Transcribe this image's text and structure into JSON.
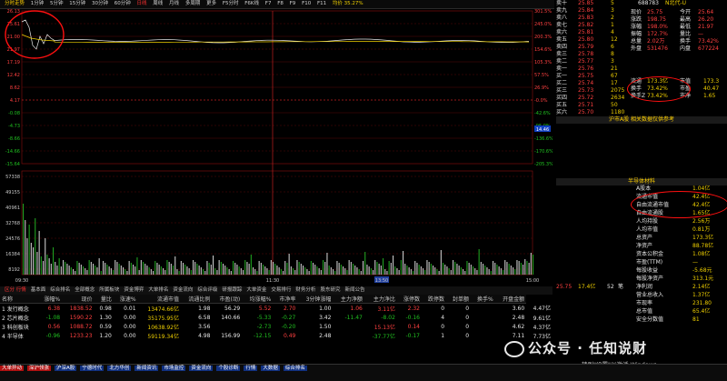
{
  "colors": {
    "up": "#ff4040",
    "down": "#20c020",
    "price_line": "#e8e8e8",
    "avg_line": "#f0d000",
    "annotation": "#ff1010"
  },
  "toolbar": {
    "items": [
      "1分钟",
      "5分钟",
      "15分钟",
      "30分钟",
      "60分钟",
      "日线",
      "周线",
      "月线",
      "多周期",
      "更多",
      "F5分时",
      "F6K线",
      "F7",
      "F8",
      "F9",
      "F10",
      "F11"
    ],
    "active_index": 5,
    "label_left": "分时走势",
    "label_right": "均价 35.27%"
  },
  "chart": {
    "left_scale": [
      "26.13",
      "25.61",
      "21.00",
      "21.97",
      "17.19",
      "12.42",
      "8.62",
      "4.17",
      "-0.08",
      "-4.73",
      "-8.66",
      "-14.66",
      "-15.64"
    ],
    "right_scale": [
      "301.5%",
      "245.0%",
      "200.3%",
      "154.6%",
      "105.3%",
      "57.5%",
      "26.9%",
      "-0.0%",
      "-42.6%",
      "-95.0%",
      "-136.6%",
      "-170.6%",
      "-205.3%"
    ],
    "volume_scale": [
      "57338",
      "49155",
      "40961",
      "32768",
      "24576",
      "16384",
      "8192"
    ],
    "time_labels": [
      "09:30",
      "11:30",
      "13:50",
      "15:00"
    ],
    "price_badge": "14.46"
  },
  "tabs": {
    "items": [
      "区分 行情",
      "基本面",
      "综合排名",
      "全部概念",
      "所属板块",
      "资金博弈",
      "大单排名",
      "资金流向",
      "综合评级",
      "研报跟踪",
      "大单资金",
      "交易排行",
      "财务分析",
      "股东研究",
      "新闻公告"
    ],
    "active_index": 0
  },
  "table": {
    "columns": [
      "名称",
      "涨幅%",
      "现价",
      "量比",
      "涨速%",
      "流通市值",
      "流通比例",
      "市盈(动)",
      "均涨幅%",
      "市净率",
      "3分钟涨幅",
      "主力净额",
      "主力净比",
      "涨停数",
      "跌停数",
      "封单额",
      "换手%",
      "开盘金额"
    ],
    "rows": [
      {
        "name": "发行概念",
        "cells": [
          "6.38",
          "1838.52",
          "0.98",
          "0.01",
          "13474.66亿",
          "1.98",
          "56.29",
          "5.52",
          "2.70",
          "1.00",
          "1.06",
          "3.11亿",
          "2.32",
          "0",
          "0",
          "",
          "3.60",
          "4.47亿"
        ]
      },
      {
        "name": "芯片概念",
        "cells": [
          "-1.08",
          "1590.22",
          "1.30",
          "0.00",
          "35175.95亿",
          "6.58",
          "140.66",
          "-5.33",
          "-0.27",
          "3.42",
          "-11.47",
          "-8.02",
          "-0.16",
          "4",
          "0",
          "",
          "2.48",
          "9.61亿"
        ]
      },
      {
        "name": "科创板块",
        "cells": [
          "0.56",
          "1088.72",
          "0.59",
          "0.00",
          "10638.92亿",
          "3.56",
          "",
          "-2.73",
          "-0.20",
          "1.50",
          "",
          "15.13亿",
          "0.14",
          "0",
          "0",
          "",
          "4.62",
          "4.37亿"
        ]
      },
      {
        "name": "半导体",
        "cells": [
          "-0.96",
          "1233.23",
          "1.20",
          "0.00",
          "59119.34亿",
          "4.98",
          "156.99",
          "-12.15",
          "0.49",
          "2.48",
          "",
          "-37.77亿",
          "-0.17",
          "1",
          "0",
          "",
          "7.11",
          "7.73亿"
        ]
      }
    ]
  },
  "right_panel": {
    "stock_code": "688783",
    "stock_name": "N北代-U",
    "rows": [
      {
        "a": "卖十",
        "b": "25.85",
        "c": "5"
      },
      {
        "a": "卖九",
        "b": "25.84",
        "c": "3"
      },
      {
        "a": "卖八",
        "b": "25.83",
        "c": "2"
      },
      {
        "a": "卖七",
        "b": "25.82",
        "c": "1"
      },
      {
        "a": "卖六",
        "b": "25.81",
        "c": "4"
      },
      {
        "a": "卖五",
        "b": "25.80",
        "c": "12"
      },
      {
        "a": "卖四",
        "b": "25.79",
        "c": "6"
      },
      {
        "a": "卖三",
        "b": "25.78",
        "c": "8"
      },
      {
        "a": "卖二",
        "b": "25.77",
        "c": "3"
      },
      {
        "a": "卖一",
        "b": "25.76",
        "c": "21"
      },
      {
        "a": "买一",
        "b": "25.75",
        "c": "67"
      },
      {
        "a": "买二",
        "b": "25.74",
        "c": "17"
      },
      {
        "a": "买三",
        "b": "25.73",
        "c": "2075"
      },
      {
        "a": "买四",
        "b": "25.72",
        "c": "2634"
      },
      {
        "a": "买五",
        "b": "25.71",
        "c": "50"
      },
      {
        "a": "买六",
        "b": "25.70",
        "c": "1180"
      }
    ],
    "quote": [
      [
        "现价",
        "25.75",
        "今开",
        "25.64"
      ],
      [
        "涨跌",
        "198.75",
        "最高",
        "26.20"
      ],
      [
        "涨幅",
        "198.0%",
        "最低",
        "21.97"
      ],
      [
        "振幅",
        "172.7%",
        "量比",
        "—"
      ],
      [
        "总量",
        "2.02万",
        "换手",
        "73.42%"
      ],
      [
        "外盘",
        "531476",
        "内盘",
        "677224"
      ]
    ],
    "ratios": [
      [
        "流通",
        "173.3亿",
        "市值",
        "173.3"
      ],
      [
        "换手",
        "73.42%",
        "市盈",
        "40.47"
      ],
      [
        "换手Z",
        "73.42%",
        "市净",
        "1.65"
      ]
    ],
    "related_header": "沪市A股  相关数据仅供参考",
    "shares_panel_title": "半导体材料",
    "shares_rows": [
      [
        "A股本",
        "1.04亿"
      ],
      [
        "流通市值",
        "42.4亿"
      ],
      [
        "自由流通市值",
        "42.4亿"
      ],
      [
        "自由流通股",
        "1.65亿"
      ],
      [
        "人均持股",
        "2.56万"
      ],
      [
        "人均市值",
        "0.81万"
      ],
      [
        "总资产",
        "173.3亿"
      ],
      [
        "净资产",
        "88.78亿"
      ],
      [
        "资本公积金",
        "1.08亿"
      ],
      [
        "市盈(TTM)",
        "—"
      ],
      [
        "每股收益",
        "-5.68元"
      ],
      [
        "每股净资产",
        "313.1元"
      ],
      [
        "净利润",
        "2.14亿"
      ],
      [
        "营业总收入",
        "1.37亿"
      ],
      [
        "市现率",
        "231.80"
      ],
      [
        "总市值",
        "65.4亿"
      ],
      [
        "安全分数值",
        "81"
      ]
    ],
    "bottom_price": [
      "25.75",
      "17.4亿",
      "52",
      "笔"
    ]
  },
  "watermark": "公众号 · 任知说财",
  "windows_notice": "转到\"设置\"以激活 Windows。",
  "status_items": [
    "大单异动",
    "深沪领涨",
    "沪深A股",
    "宁德时代",
    "北方华创",
    "新闻资讯",
    "市场监控",
    "资金流向",
    "个股诊断",
    "行情",
    "大数据",
    "综合排名"
  ]
}
